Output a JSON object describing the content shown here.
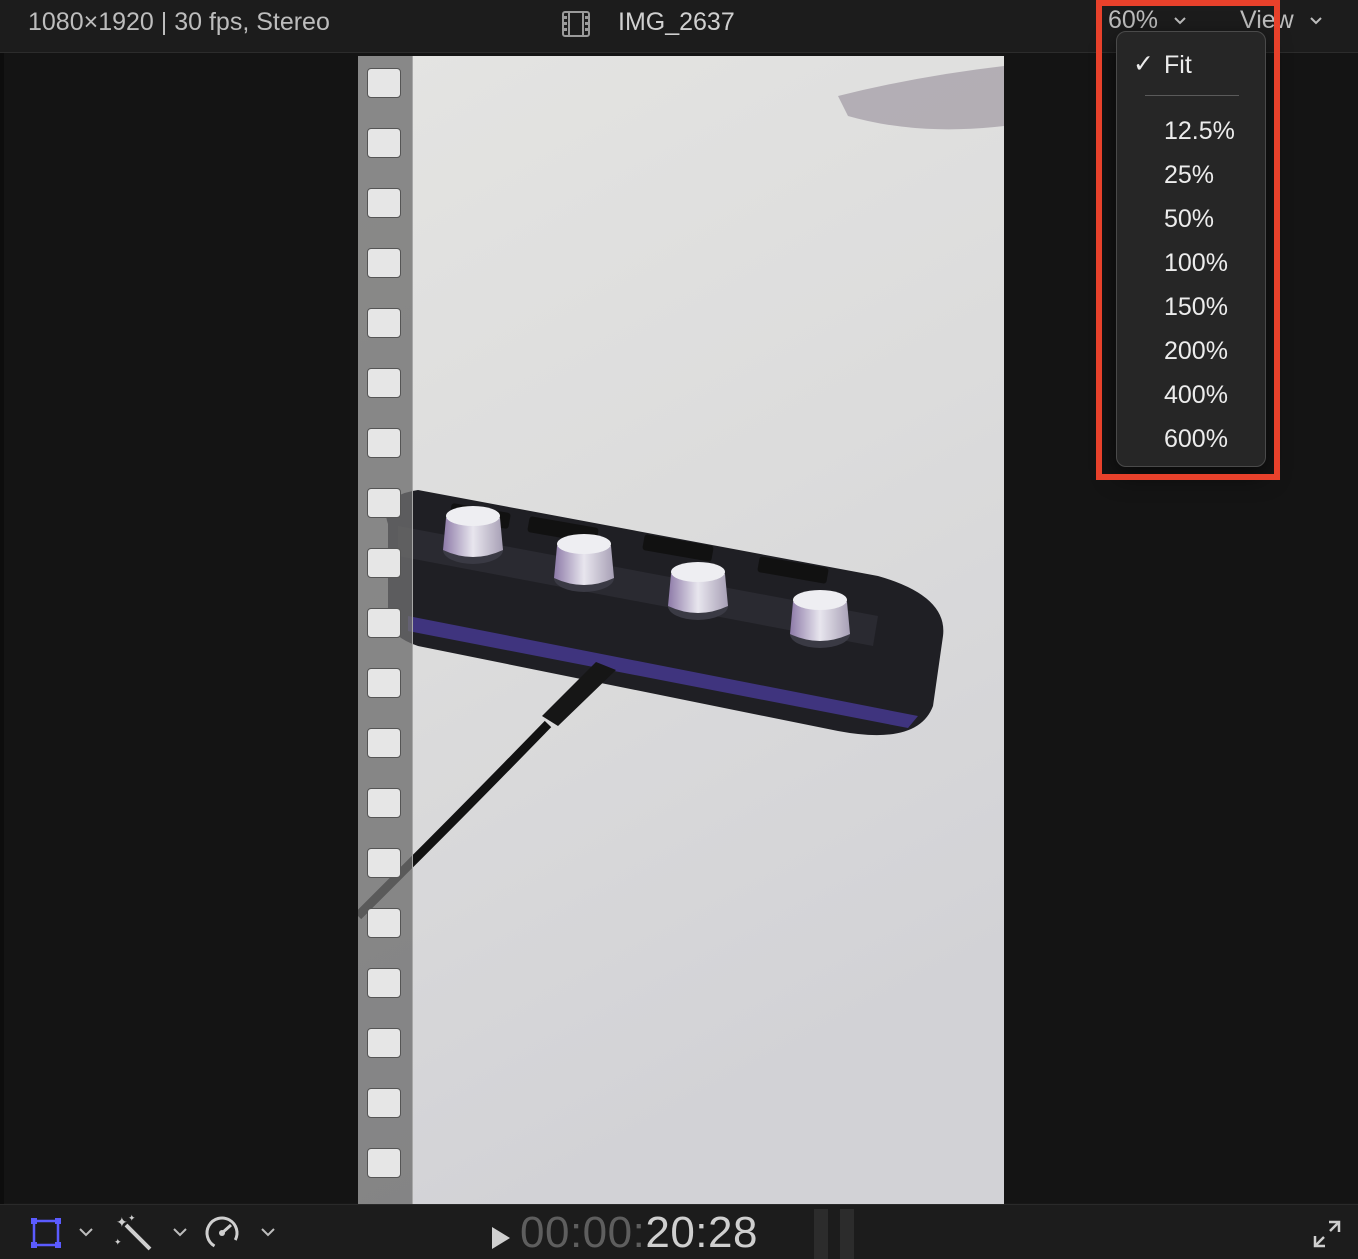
{
  "topbar": {
    "clip_info": "1080×1920 | 30 fps, Stereo",
    "clip_name": "IMG_2637",
    "zoom_value": "60%",
    "view_label": "View"
  },
  "zoom_menu": {
    "selected": "Fit",
    "items": [
      "12.5%",
      "25%",
      "50%",
      "100%",
      "150%",
      "200%",
      "400%",
      "600%"
    ]
  },
  "playback": {
    "timecode_dim": "00:00:",
    "timecode_bright": "20:28"
  },
  "colors": {
    "accent": "#5b5bff",
    "highlight_box": "#e8412b"
  },
  "icons": {
    "transform": "transform-icon",
    "enhance": "magic-wand-icon",
    "retime": "speedometer-icon",
    "play": "play-icon",
    "fullscreen": "fullscreen-icon",
    "clip": "film-strip-icon"
  }
}
